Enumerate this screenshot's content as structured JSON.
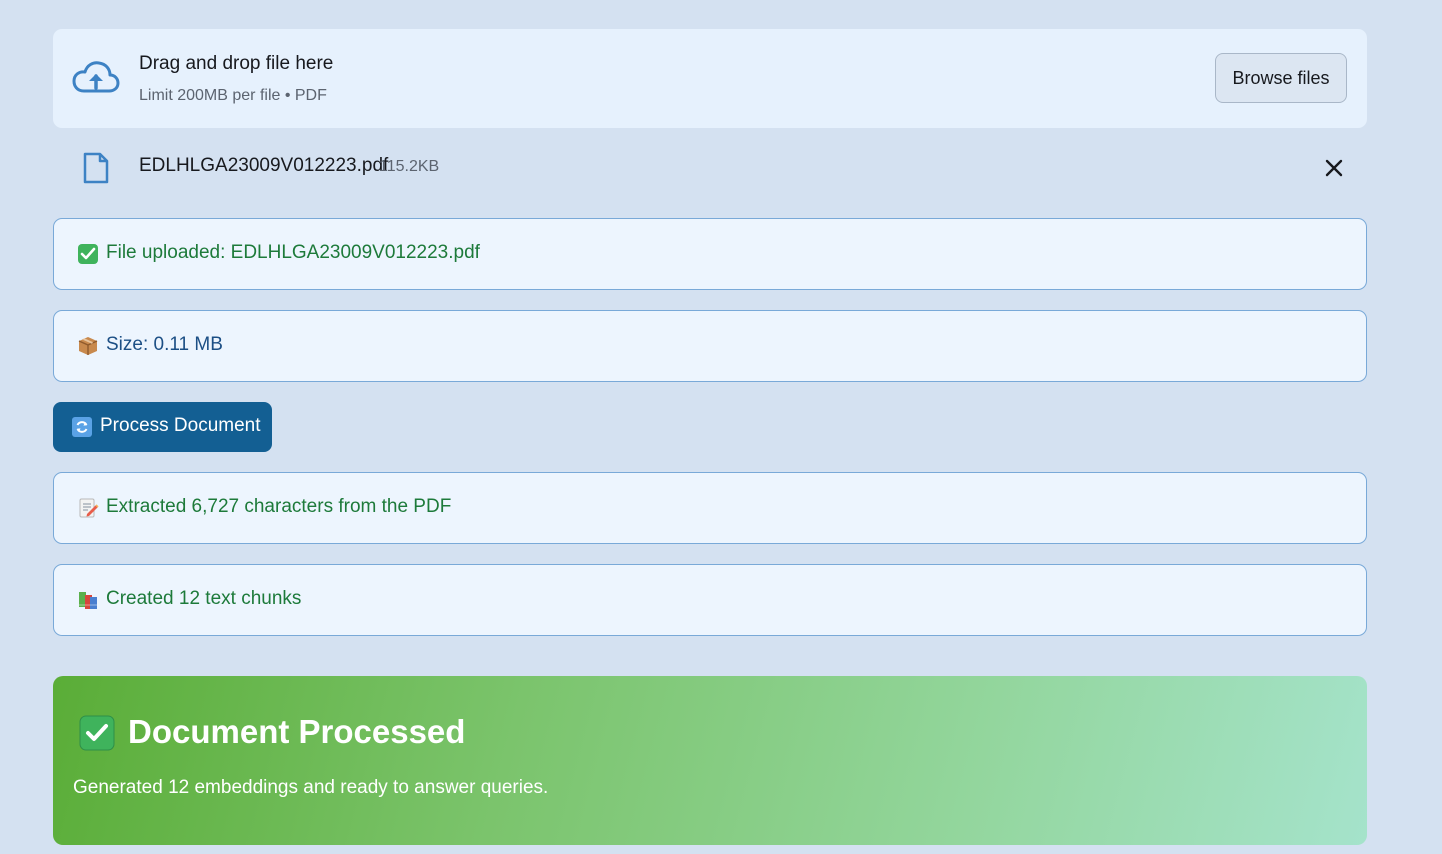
{
  "uploader": {
    "title": "Drag and drop file here",
    "limit_text": "Limit 200MB per file • PDF",
    "browse_label": "Browse files",
    "icon": "cloud-upload-icon"
  },
  "uploaded_file": {
    "name": "EDLHLGA23009V012223.pdf",
    "size": "115.2KB",
    "icon": "file-icon"
  },
  "messages": [
    {
      "icon": "check-box-emoji",
      "text": "File uploaded: EDLHLGA23009V012223.pdf",
      "tone": "success"
    },
    {
      "icon": "package-emoji",
      "text": "Size: 0.11 MB",
      "tone": "info"
    },
    {
      "icon": "memo-emoji",
      "text": "Extracted 6,727 characters from the PDF",
      "tone": "success"
    },
    {
      "icon": "books-emoji",
      "text": "Created 12 text chunks",
      "tone": "success"
    }
  ],
  "process_button": {
    "label": "Process Document",
    "icon": "refresh-icon",
    "color": "#135f93"
  },
  "success_panel": {
    "title": "Document Processed",
    "subtitle": "Generated 12 embeddings and ready to answer queries.",
    "icon": "check-box-emoji"
  }
}
